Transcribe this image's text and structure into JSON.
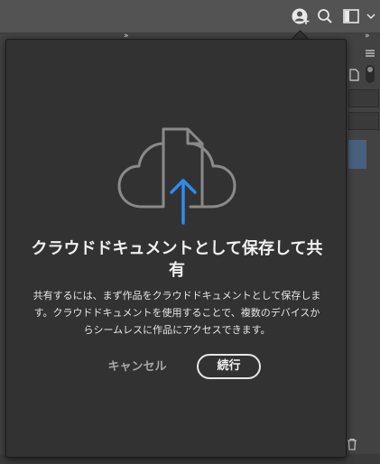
{
  "topbar": {
    "icons": [
      "share-user-icon",
      "search-icon",
      "workspace-icon",
      "chevron-down-icon"
    ],
    "collapse_glyph": "»"
  },
  "share_dialog": {
    "title": "クラウドドキュメントとして保存して共有",
    "body": "共有するには、まず作品をクラウドドキュメントとして保存します。クラウドドキュメントを使用することで、複数のデバイスからシームレスに作品にアクセスできます。",
    "cancel_label": "キャンセル",
    "continue_label": "続行",
    "illustration": "cloud-upload-icon",
    "accent_color": "#2d8ceb"
  },
  "colors": {
    "app_bg": "#535353",
    "panel_bg": "#424242",
    "dialog_bg": "#323232",
    "text_primary": "#f0f0f0",
    "text_secondary": "#a8a8a8"
  }
}
